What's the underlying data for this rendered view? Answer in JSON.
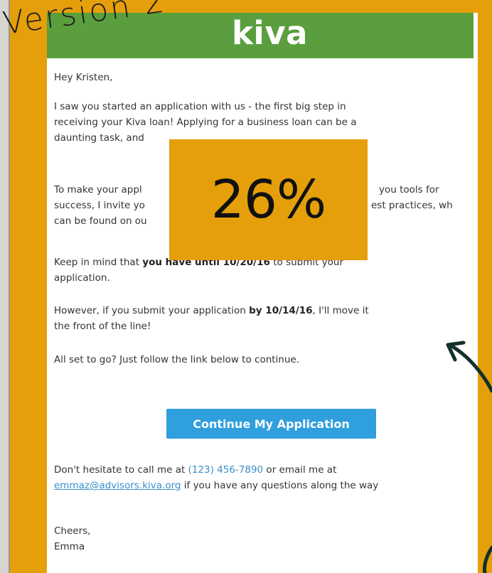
{
  "annotation": {
    "version_label": "Version 2"
  },
  "brand": {
    "logo_text": "kiva",
    "bar_color": "#5a9e3e"
  },
  "email": {
    "greeting": "Hey Kristen,",
    "p1": [
      "I saw you started an application with us - the first big step in",
      "receiving your Kiva loan! Applying for a business loan can be a",
      "daunting task, and"
    ],
    "p2": [
      "To make your appl",
      "you tools for",
      "success, I invite yo",
      "est practices, wh",
      "can be found on ou"
    ],
    "p3": {
      "before": "Keep in mind that ",
      "bold": "you have until 10/20/16",
      "after": " to submit your",
      "line2": "application."
    },
    "p4": {
      "before": "However, if you submit your application ",
      "bold": "by 10/14/16",
      "after": ", I'll move it",
      "line2": "the front of the line!"
    },
    "p5": "All set to go? Just follow the link below to continue.",
    "cta_label": "Continue My Application",
    "p6": {
      "before": "Don't hesitate to call me at ",
      "phone": "(123) 456-7890",
      "after": " or email me at",
      "email": "emmaz@advisors.kiva.org",
      "line2_after": " if you have any questions along the way"
    },
    "signoff": "Cheers,",
    "signature": "Emma"
  },
  "overlay": {
    "stat": "26%",
    "color": "#e59f0a"
  },
  "colors": {
    "background": "#e59f0a",
    "button": "#2f9fdd",
    "link": "#3a8fc9"
  }
}
